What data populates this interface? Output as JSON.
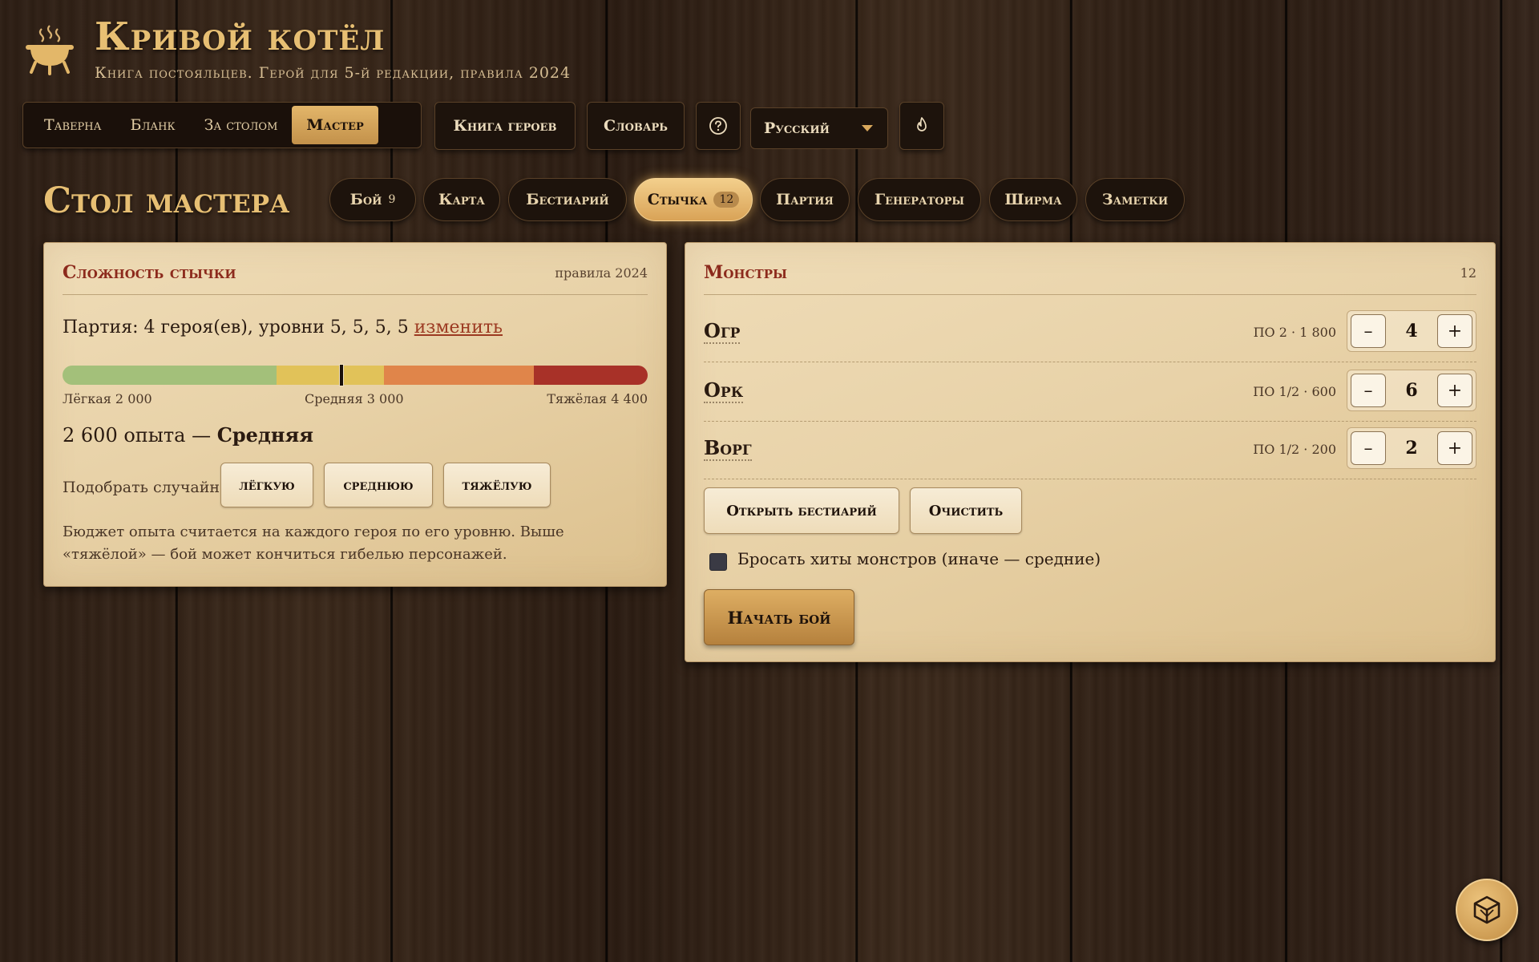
{
  "brand": {
    "title": "Кривой котёл",
    "subtitle": "Книга постояльцев. Герой для 5-й редакции, правила 2024"
  },
  "nav": {
    "tabs": [
      {
        "label": "Таверна"
      },
      {
        "label": "Бланк"
      },
      {
        "label": "За столом"
      },
      {
        "label": "Мастер",
        "active": true
      }
    ],
    "heroes_book": "Книга героев",
    "dictionary": "Словарь",
    "help_icon": "question-circle-icon",
    "language": "Русский",
    "theme_icon": "flame-icon"
  },
  "section": {
    "title": "Стол мастера",
    "subtabs": [
      {
        "label": "Бой",
        "badge": "9"
      },
      {
        "label": "Карта"
      },
      {
        "label": "Бестиарий"
      },
      {
        "label": "Стычка",
        "badge": "12",
        "active": true
      },
      {
        "label": "Партия"
      },
      {
        "label": "Генераторы"
      },
      {
        "label": "Ширма"
      },
      {
        "label": "Заметки"
      }
    ]
  },
  "difficulty": {
    "title": "Сложность стычки",
    "rules": "правила 2024",
    "party_text": "Партия: 4 героя(ев), уровни 5, 5, 5, 5",
    "change_link": "изменить",
    "bar": {
      "max": 5460,
      "current": 2600,
      "segments": [
        {
          "until": 2000,
          "color": "#a3c07a"
        },
        {
          "until": 3000,
          "color": "#e1c259"
        },
        {
          "until": 4400,
          "color": "#e0854a"
        },
        {
          "until": 5460,
          "color": "#a83128"
        }
      ]
    },
    "labels": {
      "easy": "Лёгкая 2 000",
      "medium": "Средняя 3 000",
      "hard": "Тяжёлая 4 400"
    },
    "xp_value": "2 600 опыта —",
    "xp_level": "Средняя",
    "random_label": "Подобрать случайно:",
    "random_easy": "лёгкую",
    "random_medium": "среднюю",
    "random_hard": "тяжёлую",
    "note": "Бюджет опыта считается на каждого героя по его уровню. Выше «тяжёлой» — бой может кончиться гибелью персонажей."
  },
  "monsters": {
    "title": "Монстры",
    "count": "12",
    "list": [
      {
        "name": "Огр",
        "info": "ПО 2 · 1 800",
        "qty": "4"
      },
      {
        "name": "Орк",
        "info": "ПО 1/2 · 600",
        "qty": "6"
      },
      {
        "name": "Ворг",
        "info": "ПО 1/2 · 200",
        "qty": "2"
      }
    ],
    "open_bestiary": "Открыть бестиарий",
    "clear": "Очистить",
    "roll_hp_label": "Бросать хиты монстров (иначе — средние)",
    "start_battle": "Начать бой",
    "minus": "–",
    "plus": "+"
  },
  "fab_icon": "dice-cube-icon"
}
